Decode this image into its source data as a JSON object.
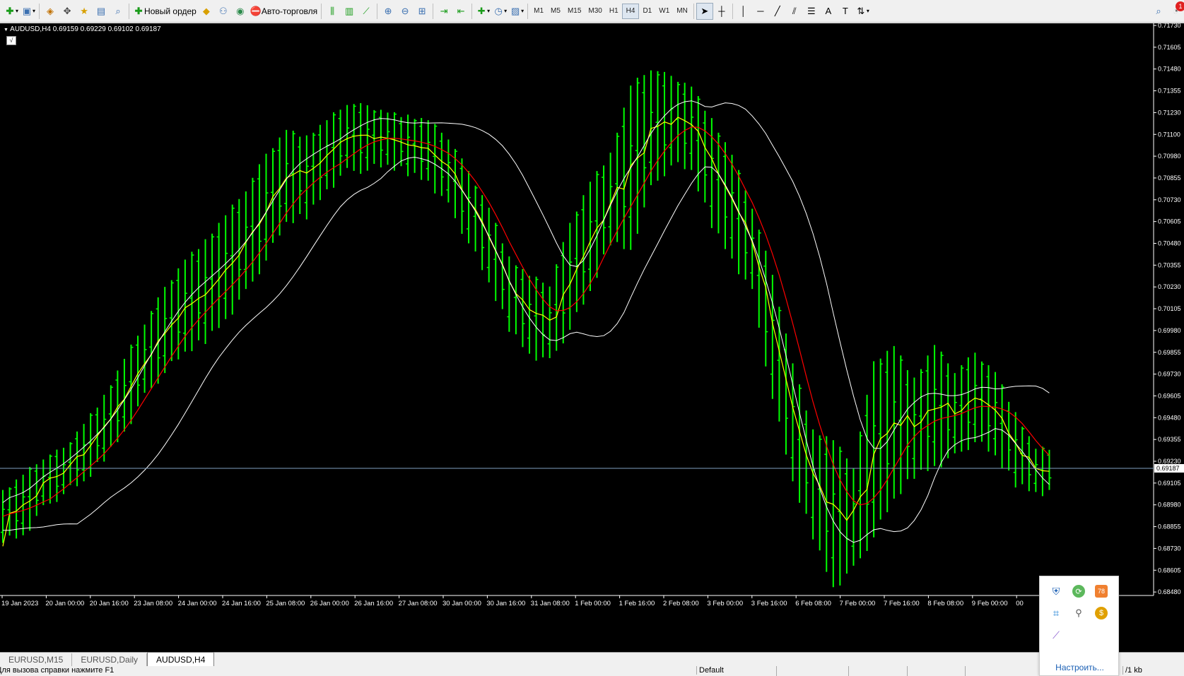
{
  "toolbar": {
    "new_order": "Новый ордер",
    "auto_trading": "Авто-торговля",
    "timeframes": [
      "M1",
      "M5",
      "M15",
      "M30",
      "H1",
      "H4",
      "D1",
      "W1",
      "MN"
    ],
    "active_timeframe": "H4",
    "notification_count": "1"
  },
  "chart": {
    "symbol_line": "AUDUSD,H4  0.69159 0.69229 0.69102 0.69187",
    "trade_button": "√",
    "current_price": "0.69187",
    "price_labels": [
      "0.71730",
      "0.71605",
      "0.71480",
      "0.71355",
      "0.71230",
      "0.71100",
      "0.70980",
      "0.70855",
      "0.70730",
      "0.70605",
      "0.70480",
      "0.70355",
      "0.70230",
      "0.70105",
      "0.69980",
      "0.69855",
      "0.69730",
      "0.69605",
      "0.69480",
      "0.69355",
      "0.69230",
      "0.69105",
      "0.68980",
      "0.68855",
      "0.68730",
      "0.68605",
      "0.68480"
    ],
    "time_labels": [
      "19 Jan 2023",
      "20 Jan 00:00",
      "20 Jan 16:00",
      "23 Jan 08:00",
      "24 Jan 00:00",
      "24 Jan 16:00",
      "25 Jan 08:00",
      "26 Jan 00:00",
      "26 Jan 16:00",
      "27 Jan 08:00",
      "30 Jan 00:00",
      "30 Jan 16:00",
      "31 Jan 08:00",
      "1 Feb 00:00",
      "1 Feb 16:00",
      "2 Feb 08:00",
      "3 Feb 00:00",
      "3 Feb 16:00",
      "6 Feb 08:00",
      "7 Feb 00:00",
      "7 Feb 16:00",
      "8 Feb 08:00",
      "9 Feb 00:00",
      "00"
    ],
    "colors": {
      "background": "#000000",
      "bars": "#00ff00",
      "ma_fast": "#ffff00",
      "ma_mid": "#ff0000",
      "bands": "#ffffff",
      "price_line": "#7f9fbf"
    }
  },
  "chart_data": {
    "type": "bar",
    "title": "AUDUSD,H4",
    "ohlc_last": {
      "open": 0.69159,
      "high": 0.69229,
      "low": 0.69102,
      "close": 0.69187
    },
    "ylim": [
      0.6846,
      0.7176
    ],
    "x": [
      "19 Jan 2023",
      "20 Jan 00:00",
      "20 Jan 16:00",
      "23 Jan 08:00",
      "24 Jan 00:00",
      "24 Jan 16:00",
      "25 Jan 08:00",
      "26 Jan 00:00",
      "26 Jan 16:00",
      "27 Jan 08:00",
      "30 Jan 00:00",
      "30 Jan 16:00",
      "31 Jan 08:00",
      "1 Feb 00:00",
      "1 Feb 16:00",
      "2 Feb 08:00",
      "3 Feb 00:00",
      "3 Feb 16:00",
      "6 Feb 08:00",
      "7 Feb 00:00",
      "7 Feb 16:00",
      "8 Feb 08:00",
      "9 Feb 00:00"
    ],
    "bars": [
      [
        0.6878,
        0.6905
      ],
      [
        0.688,
        0.6915
      ],
      [
        0.6895,
        0.6925
      ],
      [
        0.6905,
        0.693
      ],
      [
        0.691,
        0.6945
      ],
      [
        0.6925,
        0.696
      ],
      [
        0.694,
        0.6982
      ],
      [
        0.696,
        0.7003
      ],
      [
        0.6975,
        0.7023
      ],
      [
        0.6985,
        0.704
      ],
      [
        0.6993,
        0.705
      ],
      [
        0.7005,
        0.7065
      ],
      [
        0.702,
        0.708
      ],
      [
        0.704,
        0.71
      ],
      [
        0.706,
        0.7115
      ],
      [
        0.7065,
        0.711
      ],
      [
        0.708,
        0.712
      ],
      [
        0.709,
        0.713
      ],
      [
        0.7092,
        0.7128
      ],
      [
        0.7093,
        0.7125
      ],
      [
        0.709,
        0.7122
      ],
      [
        0.7085,
        0.712
      ],
      [
        0.707,
        0.711
      ],
      [
        0.705,
        0.709
      ],
      [
        0.7025,
        0.707
      ],
      [
        0.7,
        0.704
      ],
      [
        0.6985,
        0.703
      ],
      [
        0.698,
        0.7025
      ],
      [
        0.7,
        0.706
      ],
      [
        0.702,
        0.7085
      ],
      [
        0.705,
        0.71
      ],
      [
        0.7045,
        0.714
      ],
      [
        0.708,
        0.715
      ],
      [
        0.7095,
        0.7145
      ],
      [
        0.709,
        0.714
      ],
      [
        0.706,
        0.712
      ],
      [
        0.704,
        0.71
      ],
      [
        0.702,
        0.707
      ],
      [
        0.696,
        0.703
      ],
      [
        0.691,
        0.698
      ],
      [
        0.688,
        0.694
      ],
      [
        0.685,
        0.6935
      ],
      [
        0.686,
        0.692
      ],
      [
        0.688,
        0.698
      ],
      [
        0.69,
        0.699
      ],
      [
        0.6915,
        0.697
      ],
      [
        0.692,
        0.699
      ],
      [
        0.6925,
        0.6975
      ],
      [
        0.6935,
        0.6985
      ],
      [
        0.6925,
        0.6975
      ],
      [
        0.691,
        0.695
      ],
      [
        0.6905,
        0.693
      ]
    ],
    "series": [
      {
        "name": "",
        "type": "line"
      },
      {
        "name": "",
        "type": "line"
      },
      {
        "name": "",
        "type": "line"
      },
      {
        "name": "",
        "type": "line"
      }
    ]
  },
  "tabs": [
    "EURUSD,M15",
    "EURUSD,Daily",
    "AUDUSD,H4"
  ],
  "active_tab": "AUDUSD,H4",
  "status": {
    "help": "Для вызова справки нажмите F1",
    "profile": "Default",
    "traffic": "/1 kb"
  },
  "tray": {
    "customize": "Настроить...",
    "badge_78": "78"
  }
}
